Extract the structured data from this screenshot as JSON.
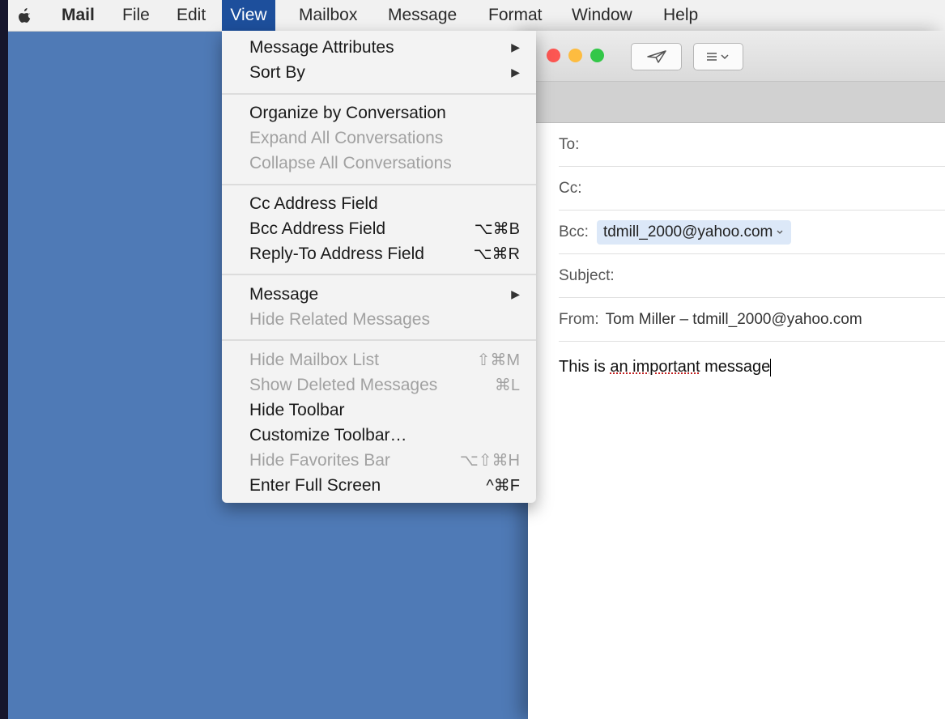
{
  "menubar": {
    "app": "Mail",
    "items": [
      "File",
      "Edit",
      "View",
      "Mailbox",
      "Message",
      "Format",
      "Window",
      "Help"
    ],
    "active": "View"
  },
  "view_menu": {
    "groups": [
      [
        {
          "label": "Message Attributes",
          "submenu": true,
          "enabled": true
        },
        {
          "label": "Sort By",
          "submenu": true,
          "enabled": true
        }
      ],
      [
        {
          "label": "Organize by Conversation",
          "enabled": true
        },
        {
          "label": "Expand All Conversations",
          "enabled": false
        },
        {
          "label": "Collapse All Conversations",
          "enabled": false
        }
      ],
      [
        {
          "label": "Cc Address Field",
          "enabled": true
        },
        {
          "label": "Bcc Address Field",
          "shortcut": "⌥⌘B",
          "enabled": true
        },
        {
          "label": "Reply-To Address Field",
          "shortcut": "⌥⌘R",
          "enabled": true
        }
      ],
      [
        {
          "label": "Message",
          "submenu": true,
          "enabled": true
        },
        {
          "label": "Hide Related Messages",
          "enabled": false
        }
      ],
      [
        {
          "label": "Hide Mailbox List",
          "shortcut": "⇧⌘M",
          "enabled": false
        },
        {
          "label": "Show Deleted Messages",
          "shortcut": "⌘L",
          "enabled": false
        },
        {
          "label": "Hide Toolbar",
          "enabled": true
        },
        {
          "label": "Customize Toolbar…",
          "enabled": true
        },
        {
          "label": "Hide Favorites Bar",
          "shortcut": "⌥⇧⌘H",
          "enabled": false
        },
        {
          "label": "Enter Full Screen",
          "shortcut": "^⌘F",
          "enabled": true
        }
      ]
    ]
  },
  "compose": {
    "to_label": "To:",
    "cc_label": "Cc:",
    "bcc_label": "Bcc:",
    "bcc_value": "tdmill_2000@yahoo.com",
    "subject_label": "Subject:",
    "from_label": "From:",
    "from_value": "Tom Miller – tdmill_2000@yahoo.com",
    "body_prefix": "This is ",
    "body_underlined": "an important",
    "body_suffix": " message"
  },
  "colors": {
    "desktop": "#4f7ab6",
    "menu_highlight": "#1d4f9c",
    "close": "#fc5753",
    "minimize": "#fdbc40",
    "zoom": "#33c748"
  },
  "icons": [
    "apple-icon",
    "send-icon",
    "format-list-icon",
    "submenu-arrow-icon",
    "chevron-down-icon"
  ]
}
